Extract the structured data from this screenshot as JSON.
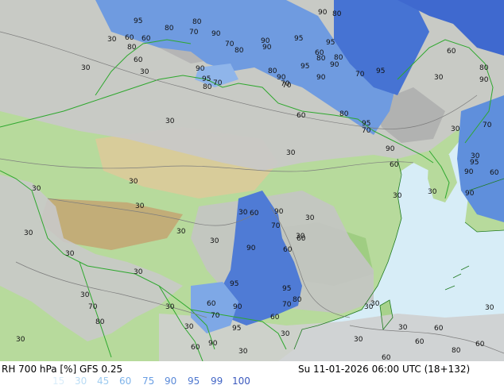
{
  "footer": {
    "title": "RH 700 hPa [%] GFS 0.25",
    "valid": "Su 11-01-2026 06:00 UTC (18+132)"
  },
  "legend": {
    "items": [
      {
        "label": "15",
        "color": "#d9ecf9"
      },
      {
        "label": "30",
        "color": "#b9dcf5"
      },
      {
        "label": "45",
        "color": "#9dcbf0"
      },
      {
        "label": "60",
        "color": "#7fb4ea"
      },
      {
        "label": "75",
        "color": "#6a9fe4"
      },
      {
        "label": "90",
        "color": "#5b8ad8"
      },
      {
        "label": "95",
        "color": "#4f78cf"
      },
      {
        "label": "99",
        "color": "#4467c6"
      },
      {
        "label": "100",
        "color": "#3a58bd"
      }
    ]
  },
  "map": {
    "colors": {
      "sea": "#d7edf7",
      "land_low": "#a8d28c",
      "land_mid": "#d3e6b2",
      "plateau": "#c8b685",
      "rh_30": "#c9c9c9",
      "rh_60": "#b0b0b0",
      "rh_90": "#5f8fdc",
      "rh_95": "#3f6ad0",
      "border": "#2ea82e"
    },
    "contour_labels": [
      "95",
      "80",
      "60",
      "30",
      "60",
      "80",
      "80",
      "70",
      "90",
      "70",
      "80",
      "90",
      "90",
      "95",
      "95",
      "80",
      "90",
      "80",
      "60",
      "70",
      "30",
      "30",
      "90",
      "95",
      "80",
      "70",
      "90",
      "80",
      "70",
      "90",
      "95",
      "60",
      "90",
      "95",
      "30",
      "60",
      "95",
      "80",
      "80",
      "70",
      "60",
      "90",
      "70",
      "30",
      "90",
      "80",
      "30",
      "30",
      "30",
      "30",
      "60",
      "30",
      "30",
      "90",
      "30",
      "95",
      "60",
      "30",
      "30",
      "70",
      "60",
      "90",
      "30",
      "90",
      "60",
      "30",
      "60",
      "30",
      "30",
      "30",
      "30",
      "30",
      "95",
      "95",
      "70",
      "90",
      "80",
      "70",
      "30",
      "60",
      "90",
      "70",
      "60",
      "30",
      "60",
      "80",
      "30",
      "60",
      "80",
      "30",
      "30",
      "90",
      "95",
      "60",
      "60",
      "30",
      "70",
      "30",
      "30",
      "30",
      "30",
      "60",
      "30"
    ]
  }
}
